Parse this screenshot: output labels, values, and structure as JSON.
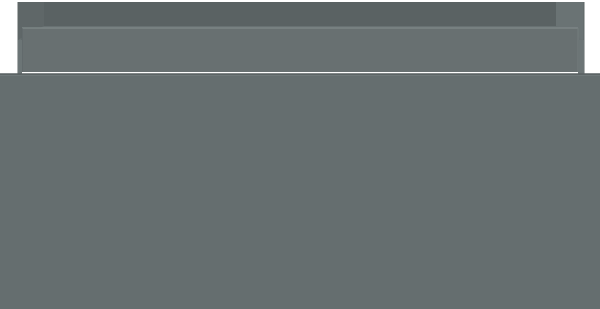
{
  "image": {
    "subject": "cabinet-drawer",
    "colors": {
      "background": "#ffffff",
      "front_face": "#656e6f",
      "top_rim": "#6f7879",
      "inner_back_wall": "#5a6263",
      "inner_floor": "#687172",
      "inner_left_wall": "#5f6768",
      "inner_right_wall": "#6a7374",
      "interior_panel": "#687071",
      "interior_panel_top": "#737c7d",
      "edge_highlight": "#7c8586",
      "edge_shadow": "#596062"
    }
  }
}
